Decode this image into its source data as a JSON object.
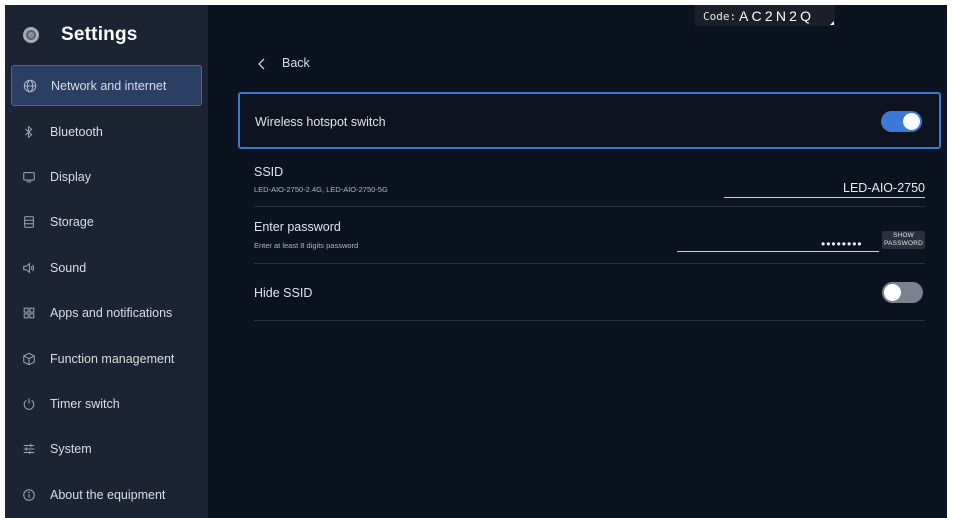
{
  "sidebar": {
    "title": "Settings",
    "items": [
      {
        "label": "Network and internet",
        "icon": "globe-icon",
        "active": true
      },
      {
        "label": "Bluetooth",
        "icon": "bluetooth-icon",
        "active": false
      },
      {
        "label": "Display",
        "icon": "monitor-icon",
        "active": false
      },
      {
        "label": "Storage",
        "icon": "storage-icon",
        "active": false
      },
      {
        "label": "Sound",
        "icon": "speaker-icon",
        "active": false
      },
      {
        "label": "Apps and notifications",
        "icon": "apps-grid-icon",
        "active": false
      },
      {
        "label": "Function management",
        "icon": "cube-icon",
        "active": false
      },
      {
        "label": "Timer switch",
        "icon": "power-icon",
        "active": false
      },
      {
        "label": "System",
        "icon": "sliders-icon",
        "active": false
      },
      {
        "label": "About the equipment",
        "icon": "info-icon",
        "active": false
      }
    ]
  },
  "code_badge": {
    "label": "Code:",
    "value": "AC2N2Q"
  },
  "header": {
    "back_label": "Back"
  },
  "hotspot": {
    "label": "Wireless hotspot switch",
    "enabled": true
  },
  "ssid": {
    "title": "SSID",
    "subtitle": "LED-AIO-2750-2.4G, LED-AIO-2750-5G",
    "value": "LED-AIO-2750"
  },
  "password": {
    "title": "Enter password",
    "subtitle": "Enter at least 8 digits password",
    "masked_value": "••••••••",
    "show_label_1": "SHOW",
    "show_label_2": "PASSWORD"
  },
  "hide_ssid": {
    "title": "Hide SSID",
    "enabled": false
  },
  "colors": {
    "background": "#0c1320",
    "sidebar": "#1c2433",
    "accent": "#3c78d6",
    "active_item": "#2a4063"
  }
}
